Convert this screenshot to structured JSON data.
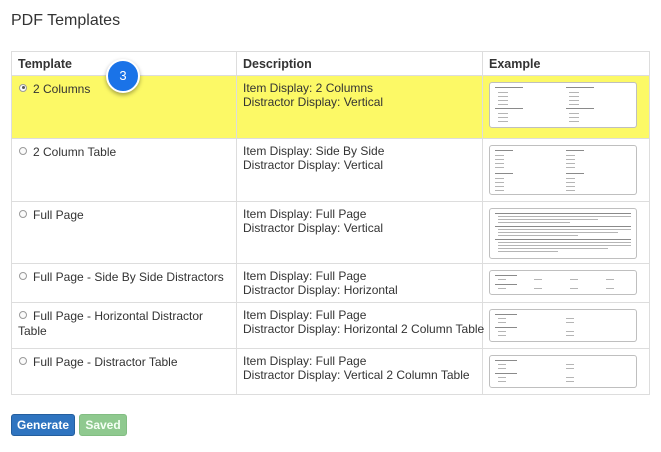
{
  "page": {
    "title": "PDF Templates"
  },
  "table": {
    "headers": {
      "template": "Template",
      "description": "Description",
      "example": "Example"
    },
    "rows": [
      {
        "template": "2 Columns",
        "selected": true,
        "item_display": "Item Display: 2 Columns",
        "distractor_display": "Distractor Display: Vertical"
      },
      {
        "template": "2 Column Table",
        "selected": false,
        "item_display": "Item Display: Side By Side",
        "distractor_display": "Distractor Display: Vertical"
      },
      {
        "template": "Full Page",
        "selected": false,
        "item_display": "Item Display: Full Page",
        "distractor_display": "Distractor Display: Vertical"
      },
      {
        "template": "Full Page - Side By Side Distractors",
        "selected": false,
        "item_display": "Item Display: Full Page",
        "distractor_display": "Distractor Display: Horizontal"
      },
      {
        "template": "Full Page - Horizontal Distractor Table",
        "selected": false,
        "item_display": "Item Display: Full Page",
        "distractor_display": "Distractor Display: Horizontal 2 Column Table"
      },
      {
        "template": "Full Page - Distractor Table",
        "selected": false,
        "item_display": "Item Display: Full Page",
        "distractor_display": "Distractor Display: Vertical 2 Column Table"
      }
    ]
  },
  "step_badge": "3",
  "buttons": {
    "generate": "Generate",
    "saved": "Saved"
  },
  "colors": {
    "selected_row": "#fcf966",
    "step_badge": "#1a73e8",
    "generate_button": "#2f74c0",
    "saved_button": "#8fc98f"
  },
  "icons": {
    "radio": "radio-button-icon",
    "preview": "template-preview-icon"
  }
}
